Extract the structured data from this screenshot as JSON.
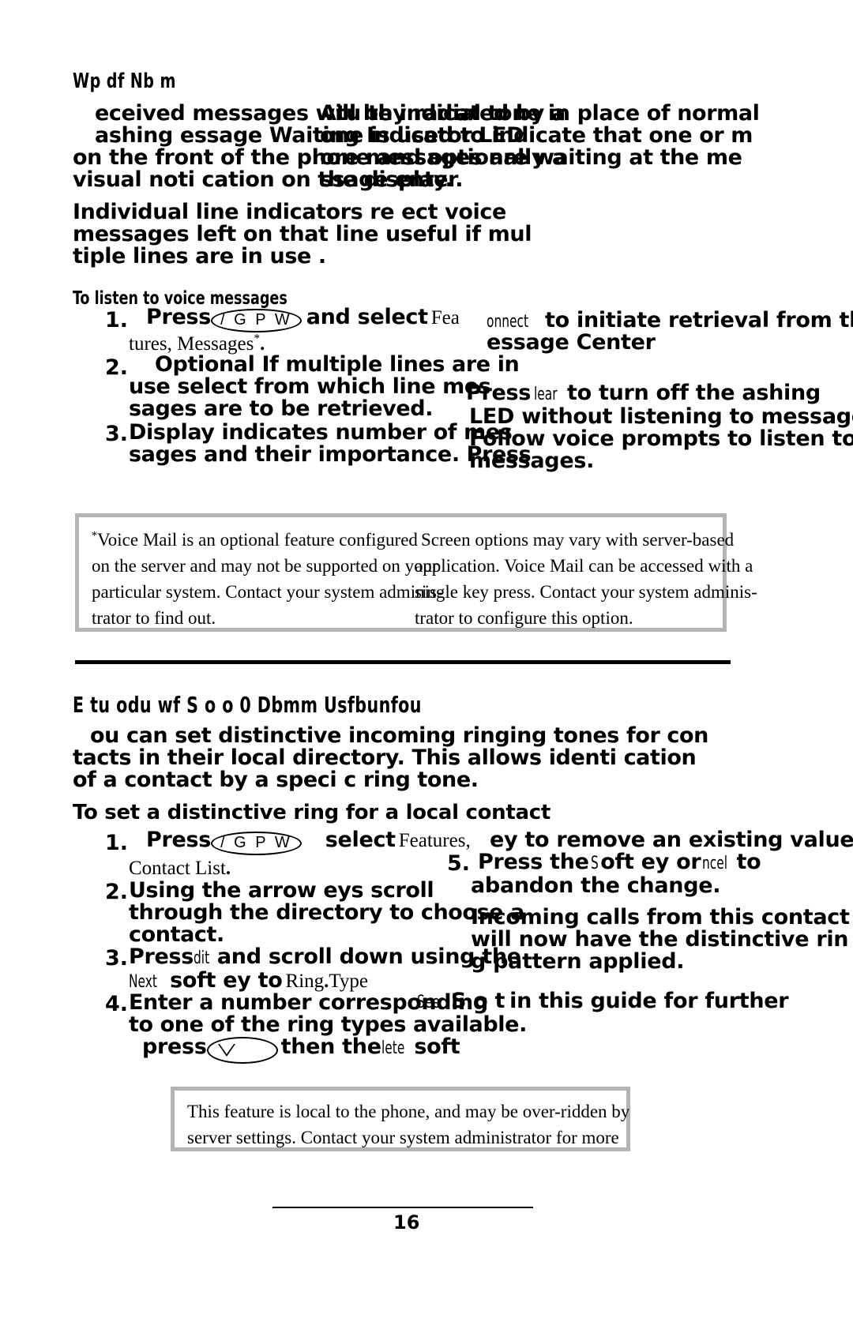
{
  "page": {
    "number": "16",
    "background": "#ffffff",
    "ink": "#000000",
    "note_border": "#b4b4b4"
  },
  "section1": {
    "kicker": "Wp  df  Nb  m",
    "intro_col_left": [
      "eceived messages will be indicated by a",
      "ashing   essage Waiting Indicator   LED",
      "on the front of the phone and optionally a",
      "visual noti   cation on the display."
    ],
    "intro_col_right": [
      "Atu  thy radial tone in place of normal",
      "one is used to indicate that one or m",
      "ore messages are waiting at the me",
      "ssage  enter."
    ],
    "note_para": [
      "Individual line indicators re   ect voice",
      "messages left on that line   useful if mul",
      "tiple lines are in use   ."
    ],
    "subhead": "To listen to voice messages",
    "steps": [
      {
        "num": "1.",
        "pre_bold": "Press",
        "key": "/ G P W",
        "mid_bold": "and select",
        "serif_run": "Fea",
        "cont_serif": "tures, Messages",
        "footnote_mark": "*",
        "trailer": "."
      },
      {
        "num": "2.",
        "lines": [
          "Optional   If multiple lines are in",
          "use   select from which line mes",
          "sages are to be retrieved."
        ]
      },
      {
        "num": "3.",
        "lines": [
          "Display indicates number of mes",
          "sages and their importance.  Press"
        ]
      }
    ],
    "right_col": {
      "line1_cond": "onnect",
      "line1_bold": "to initiate retrieval from the",
      "line2_bold": "essage Center",
      "press_bold": "Press",
      "press_cond": "lear",
      "press_rest": "to turn off the   ashing",
      "led_line": "LED without listening to messages.",
      "follow_line": "Follow voice prompts to listen to",
      "follow_line2": "messages."
    },
    "footnote_box": {
      "left": [
        "Voice Mail is an optional feature configured",
        "on the server and may not be supported on your",
        "particular system.  Contact your system adminis-",
        "trator to find out."
      ],
      "left_mark": "*",
      "right": [
        "Screen options may vary with server-based",
        "application.  Voice Mail can be accessed with a",
        "single key press.  Contact your system adminis-",
        "trator to configure this option."
      ]
    }
  },
  "section2": {
    "title": "E  tu  odu  wf  S  o     o      0   Dbmm    Usfbunfou",
    "intro": [
      "ou can set distinctive incoming ringing tones for con",
      "tacts in their local directory.  This allows identi   cation",
      "of a contact by a speci   c ring tone."
    ],
    "boldhead": "To set a distinctive ring for a local contact",
    "steps": [
      {
        "num": "1.",
        "pre_bold": "Press",
        "key": "/ G P W",
        "mid_bold": "select",
        "serif_run": "Features,",
        "cont_serif": "Contact List",
        "trailer": "."
      },
      {
        "num": "2.",
        "lines": [
          "Using the arrow   eys   scroll",
          "through the directory to choose a",
          "contact."
        ]
      },
      {
        "num": "3.",
        "pre_bold": "Press",
        "key_label": "dit",
        "rest_bold": "and scroll down using the",
        "line2_cond": "Next",
        "line2_bold": "soft   ey to",
        "line2_serif": "Ring",
        "line2_serif2": "Type"
      },
      {
        "num": "4.",
        "lines": [
          "Enter a number corresponding",
          "to one of the ring types available."
        ],
        "sub_pre": "press",
        "sub_mid": "then the",
        "sub_cond": "lete",
        "sub_post": "soft"
      },
      {
        "num": "5.",
        "top_line": "ey to remove an existing value",
        "pre_bold": "Press the",
        "cond_mid": "S",
        "rest_bold": "oft   ey or",
        "cond_cancel": "ncel",
        "tail_bold": "to",
        "line2": "abandon the change."
      }
    ],
    "right_col": {
      "line1": "Incoming calls from this contact",
      "line2": "will now have the distinctive rin",
      "line3": "g pattern applied.",
      "see_cond": "See",
      "see_bold": "S  o      t",
      "see_rest": "in this guide for further"
    },
    "notebox": [
      "This feature is local to the phone, and may be over-ridden by",
      "server settings.  Contact your system administrator for more"
    ]
  }
}
